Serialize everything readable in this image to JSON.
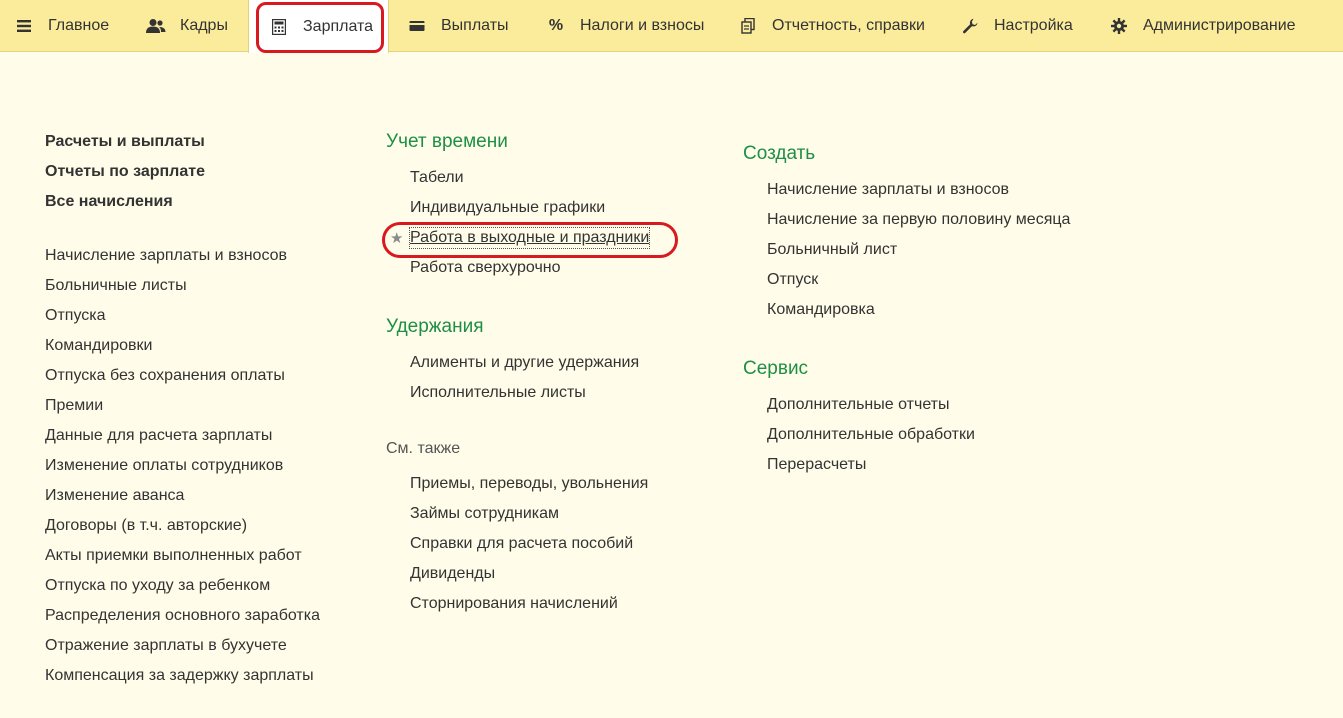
{
  "topnav": {
    "tabs": [
      {
        "label": "Главное",
        "icon": "hamburger-icon"
      },
      {
        "label": "Кадры",
        "icon": "people-icon"
      },
      {
        "label": "Зарплата",
        "icon": "calculator-icon",
        "active": true
      },
      {
        "label": "Выплаты",
        "icon": "wallet-icon"
      },
      {
        "label": "Налоги и взносы",
        "icon": "percent-icon"
      },
      {
        "label": "Отчетность, справки",
        "icon": "documents-icon"
      },
      {
        "label": "Настройка",
        "icon": "wrench-icon"
      },
      {
        "label": "Администрирование",
        "icon": "gear-icon"
      }
    ]
  },
  "left": {
    "main_links": [
      "Расчеты и выплаты",
      "Отчеты по зарплате",
      "Все начисления"
    ],
    "links": [
      "Начисление зарплаты и взносов",
      "Больничные листы",
      "Отпуска",
      "Командировки",
      "Отпуска без сохранения оплаты",
      "Премии",
      "Данные для расчета зарплаты",
      "Изменение оплаты сотрудников",
      "Изменение аванса",
      "Договоры (в т.ч. авторские)",
      "Акты приемки выполненных работ",
      "Отпуска по уходу за ребенком",
      "Распределения основного заработка",
      "Отражение зарплаты в бухучете",
      "Компенсация за задержку зарплаты"
    ]
  },
  "middle": {
    "time_title": "Учет времени",
    "time_links": [
      "Табели",
      "Индивидуальные графики",
      "Работа в выходные и праздники",
      "Работа сверхурочно"
    ],
    "deductions_title": "Удержания",
    "deductions_links": [
      "Алименты и другие удержания",
      "Исполнительные листы"
    ],
    "see_also_title": "См. также",
    "see_also_links": [
      "Приемы, переводы, увольнения",
      "Займы сотрудникам",
      "Справки для расчета пособий",
      "Дивиденды",
      "Сторнирования начислений"
    ]
  },
  "right": {
    "create_title": "Создать",
    "create_links": [
      "Начисление зарплаты и взносов",
      "Начисление за первую половину месяца",
      "Больничный лист",
      "Отпуск",
      "Командировка"
    ],
    "service_title": "Сервис",
    "service_links": [
      "Дополнительные отчеты",
      "Дополнительные обработки",
      "Перерасчеты"
    ]
  },
  "colors": {
    "nav_background": "#fbec9c",
    "page_background": "#fffde9",
    "section_title": "#1e8f46",
    "highlight": "#d91920"
  }
}
